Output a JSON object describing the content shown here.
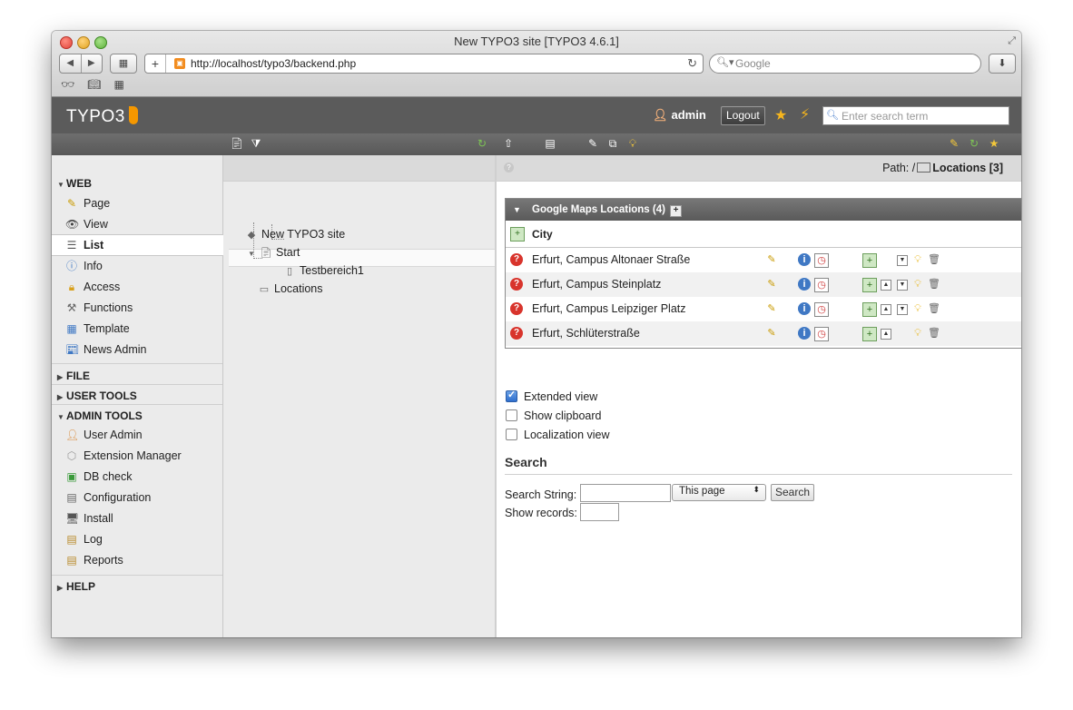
{
  "browser": {
    "window_title": "New TYPO3 site [TYPO3 4.6.1]",
    "url": "http://localhost/typo3/backend.php",
    "search_placeholder": "Google",
    "url_plus": "+"
  },
  "header": {
    "logo": "TYPO3",
    "username": "admin",
    "logout_label": "Logout",
    "search_placeholder": "Enter search term"
  },
  "modules": {
    "web": {
      "label": "WEB",
      "items": [
        "Page",
        "View",
        "List",
        "Info",
        "Access",
        "Functions",
        "Template",
        "News Admin"
      ]
    },
    "file": {
      "label": "FILE"
    },
    "user_tools": {
      "label": "USER TOOLS"
    },
    "admin_tools": {
      "label": "ADMIN TOOLS",
      "items": [
        "User Admin",
        "Extension Manager",
        "DB check",
        "Configuration",
        "Install",
        "Log",
        "Reports"
      ]
    },
    "help": {
      "label": "HELP"
    },
    "active": "List"
  },
  "tree": {
    "root": "New TYPO3 site",
    "start": "Start",
    "child": "Testbereich1",
    "selected": "Locations"
  },
  "content": {
    "path_label": "Path: /",
    "path_value": "Locations [3]",
    "panel_title": "Google Maps Locations (4)",
    "panel_plus": "+",
    "column_header": "City",
    "rows": [
      "Erfurt, Campus Altonaer Straße",
      "Erfurt, Campus Steinplatz",
      "Erfurt, Campus Leipziger Platz",
      "Erfurt, Schlüterstraße"
    ],
    "options": {
      "extended_view": "Extended view",
      "show_clipboard": "Show clipboard",
      "localization_view": "Localization view"
    },
    "search": {
      "title": "Search",
      "string_label": "Search String:",
      "scope_value": "This page",
      "button": "Search",
      "records_label": "Show records:"
    }
  }
}
